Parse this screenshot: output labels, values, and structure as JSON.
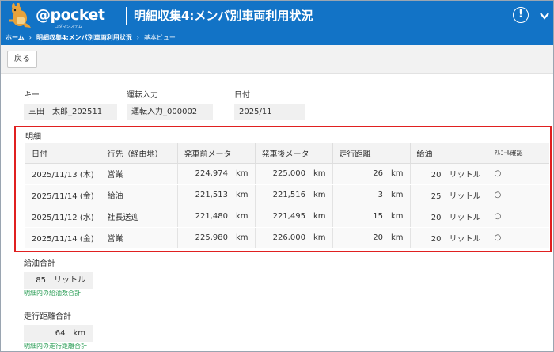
{
  "header": {
    "logo_text": "@pocket",
    "logo_sub": "コダマシステム",
    "title": "明細収集4:メンバ別車両利用状況",
    "info_icon_glyph": "!",
    "color": "#1273c6"
  },
  "breadcrumb": [
    "ホーム",
    "明細収集4:メンバ別車両利用状況",
    "基本ビュー"
  ],
  "toolbar": {
    "back_label": "戻る"
  },
  "fields": {
    "key": {
      "label": "キー",
      "value": "三田　太郎_202511"
    },
    "driving_input": {
      "label": "運転入力",
      "value": "運転入力_000002"
    },
    "date": {
      "label": "日付",
      "value": "2025/11"
    }
  },
  "detail": {
    "label": "明細",
    "columns": [
      "日付",
      "行先（経由地）",
      "発車前メータ",
      "発車後メータ",
      "走行距離",
      "給油",
      "ｱﾙｺｰﾙ確認"
    ],
    "rows": [
      {
        "date": "2025/11/13 (木)",
        "dest": "営業",
        "meter_before": "224,974",
        "meter_after": "225,000",
        "distance": "26",
        "fuel": "20",
        "alcohol": "○"
      },
      {
        "date": "2025/11/14 (金)",
        "dest": "給油",
        "meter_before": "221,513",
        "meter_after": "221,516",
        "distance": "3",
        "fuel": "25",
        "alcohol": "○"
      },
      {
        "date": "2025/11/12 (水)",
        "dest": "社長送迎",
        "meter_before": "221,480",
        "meter_after": "221,495",
        "distance": "15",
        "fuel": "20",
        "alcohol": "○"
      },
      {
        "date": "2025/11/14 (金)",
        "dest": "営業",
        "meter_before": "225,980",
        "meter_after": "226,000",
        "distance": "20",
        "fuel": "20",
        "alcohol": "○"
      }
    ],
    "unit_km": "km",
    "unit_liter": "リットル"
  },
  "fuel_total": {
    "label": "給油合計",
    "value": "85",
    "unit": "リットル",
    "hint": "明細内の給油数合計"
  },
  "distance_total": {
    "label": "走行距離合計",
    "value": "64",
    "unit": "km",
    "hint": "明細内の走行距離合計"
  }
}
